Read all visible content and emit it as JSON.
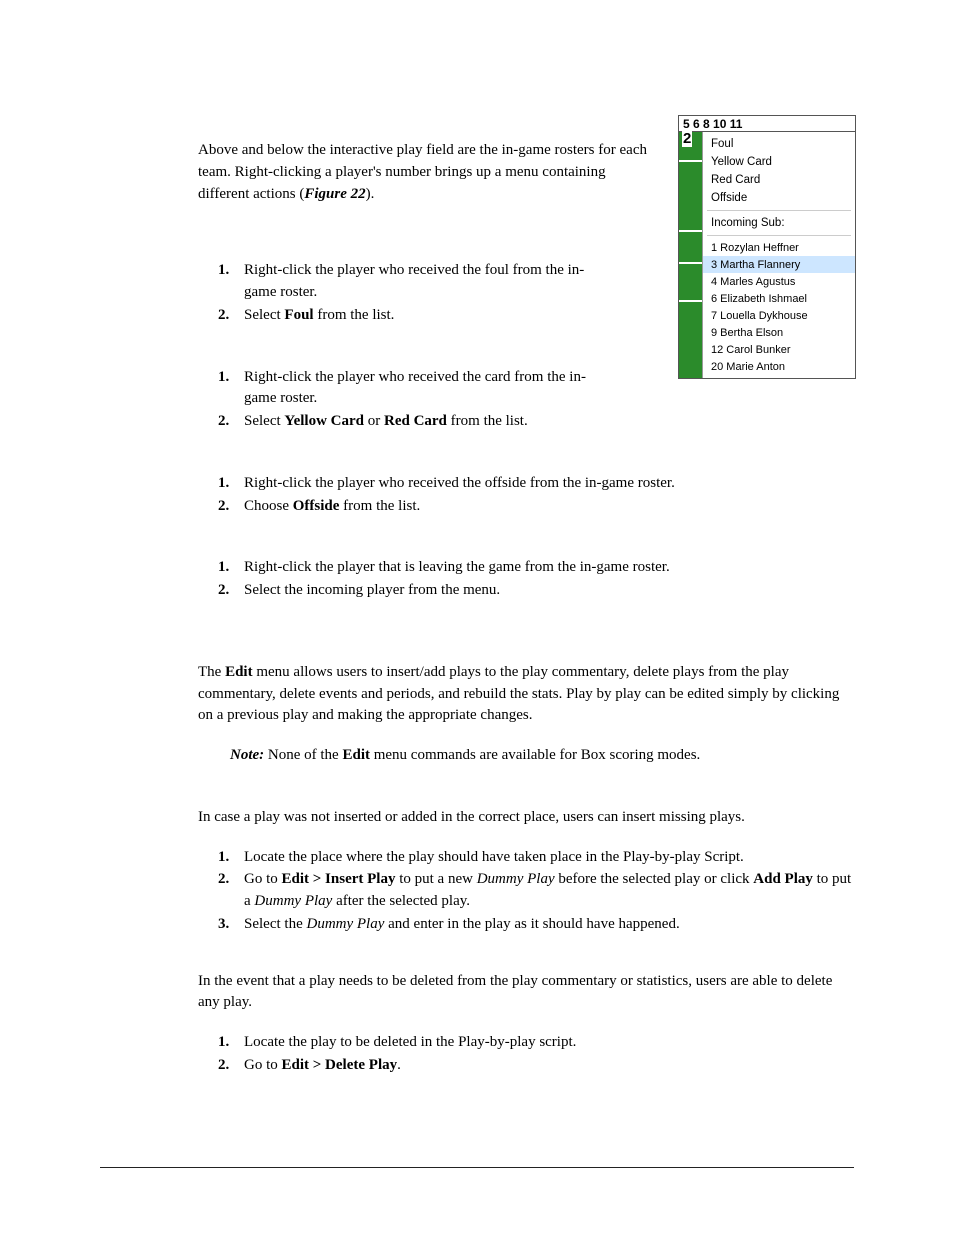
{
  "intro": "Above and below the interactive play field are the in-game rosters for each team. Right-clicking a player's number brings up a menu containing different actions (",
  "intro_figref": "Figure 22",
  "intro_end": ").",
  "foul": {
    "s1": "Right-click the player who received the foul from the in-game roster.",
    "s2a": "Select ",
    "s2b": "Foul",
    "s2c": " from the list."
  },
  "card": {
    "s1": "Right-click the player who received the card from the in-game roster.",
    "s2a": "Select ",
    "s2b": "Yellow Card",
    "s2c": " or ",
    "s2d": "Red Card",
    "s2e": " from the list."
  },
  "offside": {
    "s1": "Right-click the player who received the offside from the in-game roster.",
    "s2a": "Choose ",
    "s2b": "Offside",
    "s2c": " from the list."
  },
  "sub": {
    "s1": "Right-click the player that is leaving the game from the in-game roster.",
    "s2": "Select the incoming player from the menu."
  },
  "edit_intro_a": "The ",
  "edit_intro_b": "Edit",
  "edit_intro_c": " menu allows users to insert/add plays to the play commentary, delete plays from the play commentary, delete events and periods, and rebuild the stats. Play by play can be edited simply by clicking on a previous play and making the appropriate changes.",
  "note_a": "Note:",
  "note_b": " None of the ",
  "note_c": "Edit",
  "note_d": " menu commands are available for Box scoring modes.",
  "insert_intro": "In case a play was not inserted or added in the correct place, users can insert missing plays.",
  "insert": {
    "s1": "Locate the place where the play should have taken place in the Play-by-play Script.",
    "s2a": "Go to ",
    "s2b": "Edit > Insert Play",
    "s2c": " to put a new ",
    "s2d": "Dummy Play",
    "s2e": " before the selected play or click ",
    "s2f": "Add Play",
    "s2g": " to put a ",
    "s2h": "Dummy Play",
    "s2i": " after the selected play.",
    "s3a": "Select the ",
    "s3b": "Dummy Play",
    "s3c": " and enter in the play as it should have happened."
  },
  "delete_intro": "In the event that a play needs to be deleted from the play commentary or statistics, users are able to delete any play.",
  "delete": {
    "s1": "Locate the play to be deleted in the Play-by-play script.",
    "s2a": "Go to ",
    "s2b": "Edit > Delete Play",
    "s2c": "."
  },
  "menu": {
    "top_numbers": "5   6   8     10     11",
    "num2": "2",
    "foul": "Foul",
    "yellow": "Yellow Card",
    "red": "Red Card",
    "offside": "Offside",
    "incoming": "Incoming Sub:",
    "p1": "1 Rozylan Heffner",
    "p3": "3 Martha Flannery",
    "p4": "4 Marles Agustus",
    "p6": "6 Elizabeth Ishmael",
    "p7": "7 Louella Dykhouse",
    "p9": "9 Bertha Elson",
    "p12": "12 Carol Bunker",
    "p20": "20 Marie Anton"
  }
}
